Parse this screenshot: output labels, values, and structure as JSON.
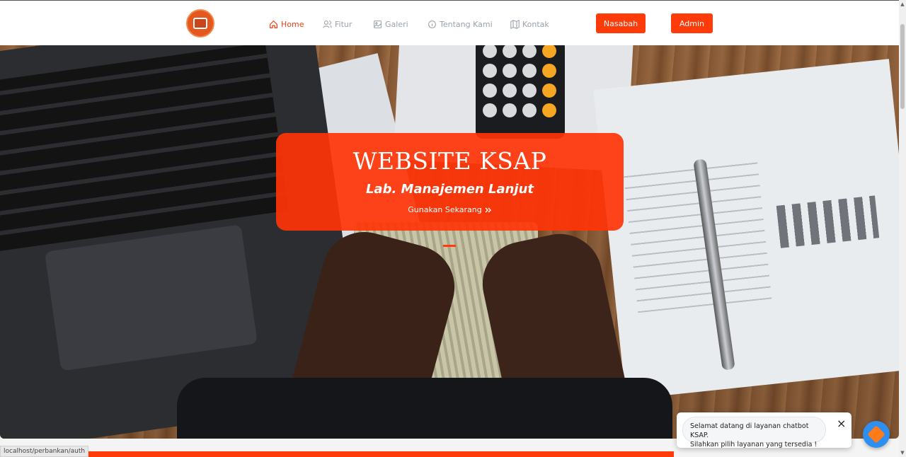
{
  "nav": {
    "items": [
      {
        "label": "Home",
        "icon": "home-icon",
        "active": true
      },
      {
        "label": "Fitur",
        "icon": "users-icon",
        "active": false
      },
      {
        "label": "Galeri",
        "icon": "image-icon",
        "active": false
      },
      {
        "label": "Tentang Kami",
        "icon": "info-icon",
        "active": false
      },
      {
        "label": "Kontak",
        "icon": "map-icon",
        "active": false
      }
    ],
    "nasabah_label": "Nasabah",
    "admin_label": "Admin"
  },
  "hero": {
    "title": "WEBSITE KSAP",
    "subtitle": "Lab. Manajemen Lanjut",
    "cta_label": "Gunakan Sekarang",
    "cta_icon": "double-chevron-right-icon"
  },
  "chat": {
    "line1": "Selamat datang di layanan chatbot KSAP.",
    "line2": "Silahkan pilih layanan yang tersedia !",
    "close_icon": "×"
  },
  "status": {
    "url": "localhost/perbankan/auth"
  },
  "colors": {
    "accent": "#ff3b0a",
    "nav_inactive": "#9aa0aa",
    "chat_fab": "#2e8ff0"
  }
}
